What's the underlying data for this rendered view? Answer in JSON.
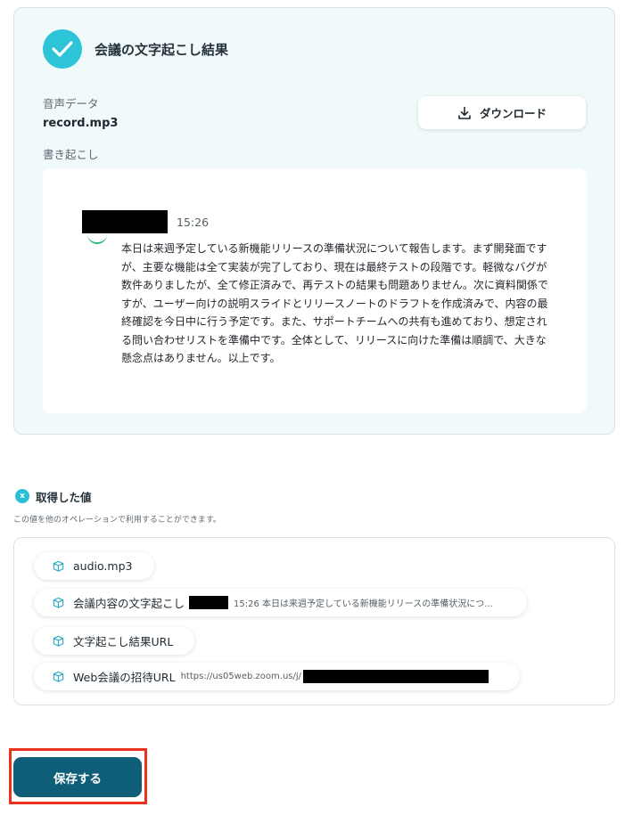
{
  "result": {
    "title": "会議の文字起こし結果",
    "audio_label": "音声データ",
    "filename": "record.mp3",
    "transcript_label": "書き起こし",
    "download_label": "ダウンロード",
    "message_time": "15:26",
    "message_body": "本日は来週予定している新機能リリースの準備状況について報告します。まず開発面ですが、主要な機能は全て実装が完了しており、現在は最終テストの段階です。軽微なバグが数件ありましたが、全て修正済みで、再テストの結果も問題ありません。次に資料関係ですが、ユーザー向けの説明スライドとリリースノートのドラフトを作成済みで、内容の最終確認を今日中に行う予定です。また、サポートチームへの共有も進めており、想定される問い合わせリストを準備中です。全体として、リリースに向けた準備は順調で、大きな懸念点はありません。以上です。"
  },
  "acquired": {
    "icon_letter": "x",
    "title": "取得した値",
    "description": "この値を他のオペレーションで利用することができます。",
    "items": [
      {
        "label": "audio.mp3",
        "preview": ""
      },
      {
        "label": "会議内容の文字起こし",
        "preview": "15:26 本日は来週予定している新機能リリースの準備状況につ..."
      },
      {
        "label": "文字起こし結果URL",
        "preview": ""
      },
      {
        "label": "Web会議の招待URL",
        "preview": "https://us05web.zoom.us/j/"
      }
    ]
  },
  "save_label": "保存する",
  "colors": {
    "accent": "#2dc4d8",
    "save_button": "#0f5e78",
    "highlight_border": "#e8321e",
    "card_background": "#f1fafa"
  }
}
